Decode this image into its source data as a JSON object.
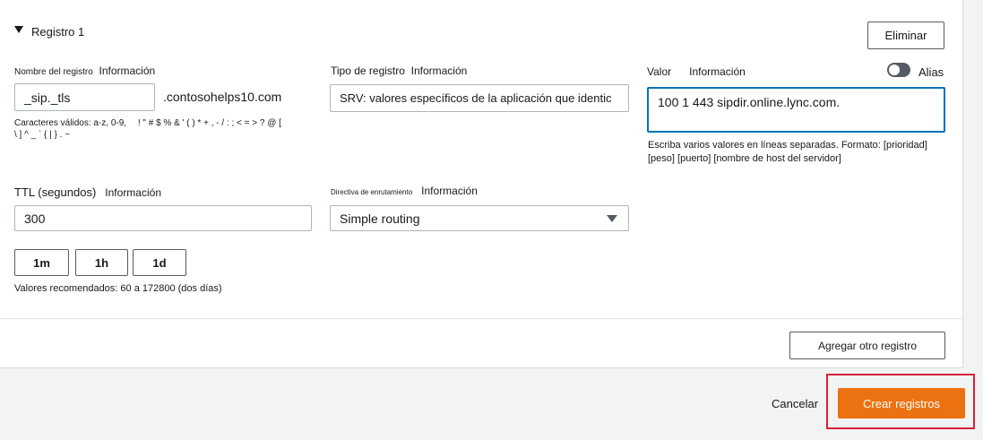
{
  "section": {
    "title": "Registro 1",
    "delete_label": "Eliminar"
  },
  "record_name": {
    "label": "Nombre del registro",
    "info": "Información",
    "value": "_sip._tls",
    "domain_suffix": ".contosohelps10.com",
    "hint_prefix": "Caracteres válidos: a-z, 0-9,",
    "hint_chars_line1": "! \" # $ % & ' ( ) * + , - / : ; < = > ? @ [",
    "hint_chars_line2": "\\ ] ^ _ ` { | } . ~"
  },
  "record_type": {
    "label": "Tipo de registro",
    "info": "Información",
    "value": "SRV: valores específicos de la aplicación que identic"
  },
  "value_field": {
    "label": "Valor",
    "info": "Información",
    "alias_label": "Alias",
    "value": "100 1 443 sipdir.online.lync.com.",
    "hint_line1": "Escriba varios valores en líneas separadas. Formato: [prioridad]",
    "hint_line2": "[peso] [puerto] [nombre de host del servidor]"
  },
  "ttl": {
    "label": "TTL (segundos)",
    "info": "Información",
    "value": "300",
    "presets": [
      "1m",
      "1h",
      "1d"
    ],
    "hint": "Valores recomendados: 60 a 172800 (dos días)"
  },
  "routing": {
    "label": "Directiva de enrutamiento",
    "info": "Información",
    "value": "Simple routing"
  },
  "footer": {
    "add_record_label": "Agregar otro registro",
    "cancel_label": "Cancelar",
    "create_label": "Crear registros"
  },
  "colors": {
    "primary": "#ec7211",
    "highlight": "#d9213b",
    "focus": "#0073bb"
  }
}
